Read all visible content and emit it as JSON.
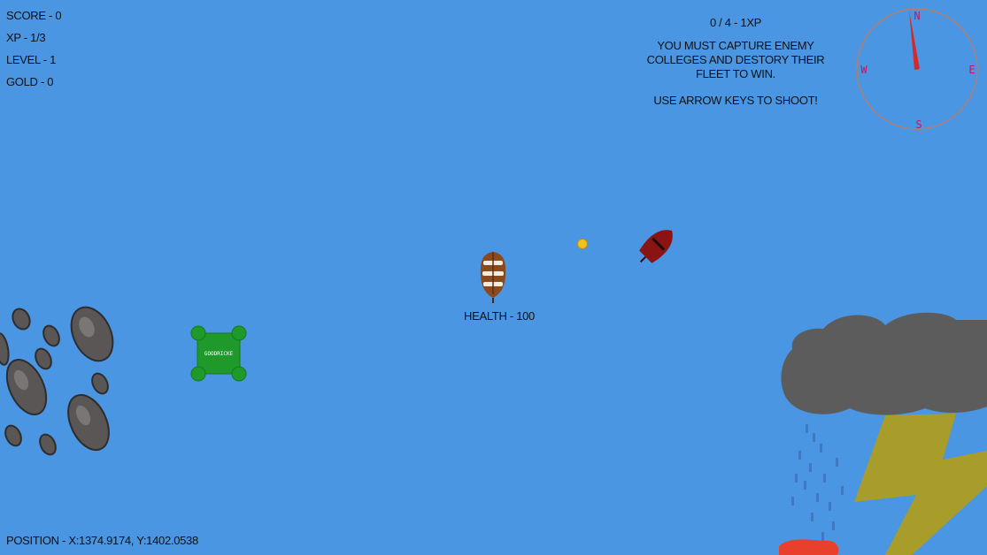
{
  "hud": {
    "score": "SCORE - 0",
    "xp": "XP - 1/3",
    "level": "LEVEL - 1",
    "gold": "GOLD - 0",
    "progress": "0 / 4 - 1XP",
    "objective": "YOU MUST CAPTURE ENEMY COLLEGES AND DESTORY THEIR FLEET TO WIN.",
    "hint": "USE ARROW KEYS TO SHOOT!",
    "position": "POSITION - X:1374.9174, Y:1402.0538"
  },
  "player": {
    "health_label": "HEALTH - 100",
    "ship_color": "#8b4a1e"
  },
  "college": {
    "name": "GOODRICKE",
    "color": "#1f9a2a"
  },
  "enemy_ship": {
    "color": "#8a1414"
  },
  "compass": {
    "north": "N",
    "south": "S",
    "east": "E",
    "west": "W",
    "ring_color": "#c47a5a",
    "needle_color": "#d22b2b"
  },
  "colors": {
    "ocean": "#4a96e2",
    "storm_cloud": "#5c5c5c",
    "lightning": "#a89c2a",
    "rock": "#5a5656"
  }
}
